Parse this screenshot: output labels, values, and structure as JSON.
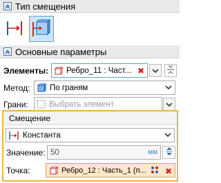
{
  "section_type": {
    "title": "Тип смещения"
  },
  "section_main": {
    "title": "Основные параметры"
  },
  "elements": {
    "label": "Элементы:",
    "value": "Ребро_11 : Част..."
  },
  "method": {
    "label": "Метод:",
    "value": "По граням"
  },
  "faces": {
    "label": "Грани:",
    "placeholder": "Выбрать элемент"
  },
  "offset_group": {
    "title": "Смещение",
    "mode": "Константа",
    "value_label": "Значение:",
    "value": "50",
    "unit": "мм",
    "point_label": "Точка:",
    "point_value": "Ребро_12 : Часть_1 (п..."
  },
  "colors": {
    "accent_blue": "#1f5fbf",
    "delete_red": "#d02020",
    "highlight_orange": "#f0b23a",
    "point_bg": "#fde8c8"
  }
}
